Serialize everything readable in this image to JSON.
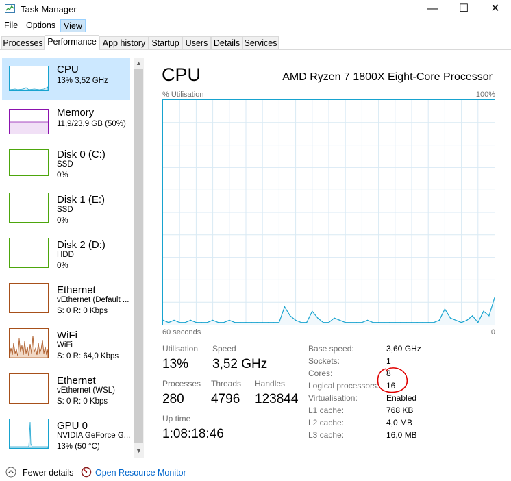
{
  "window": {
    "title": "Task Manager",
    "minimize": "—",
    "maximize": "☐",
    "close": "✕"
  },
  "menu": {
    "file": "File",
    "options": "Options",
    "view": "View"
  },
  "tabs": [
    "Processes",
    "Performance",
    "App history",
    "Startup",
    "Users",
    "Details",
    "Services"
  ],
  "sidebar": [
    {
      "name": "CPU",
      "sub1": "13%  3,52 GHz",
      "sub2": "",
      "color": "#17a3cf"
    },
    {
      "name": "Memory",
      "sub1": "11,9/23,9 GB (50%)",
      "sub2": "",
      "color": "#8b12ae"
    },
    {
      "name": "Disk 0 (C:)",
      "sub1": "SSD",
      "sub2": "0%",
      "color": "#4da60c"
    },
    {
      "name": "Disk 1 (E:)",
      "sub1": "SSD",
      "sub2": "0%",
      "color": "#4da60c"
    },
    {
      "name": "Disk 2 (D:)",
      "sub1": "HDD",
      "sub2": "0%",
      "color": "#4da60c"
    },
    {
      "name": "Ethernet",
      "sub1": "vEthernet (Default ...",
      "sub2": "S: 0  R: 0 Kbps",
      "color": "#a7501a"
    },
    {
      "name": "WiFi",
      "sub1": "WiFi",
      "sub2": "S: 0  R: 64,0 Kbps",
      "color": "#a7501a"
    },
    {
      "name": "Ethernet",
      "sub1": "vEthernet (WSL)",
      "sub2": "S: 0  R: 0 Kbps",
      "color": "#a7501a"
    },
    {
      "name": "GPU 0",
      "sub1": "NVIDIA GeForce G...",
      "sub2": "13%  (50 °C)",
      "color": "#17a3cf"
    }
  ],
  "main": {
    "title": "CPU",
    "processor": "AMD Ryzen 7 1800X Eight-Core Processor",
    "y_label": "% Utilisation",
    "y_max": "100%",
    "x_label": "60 seconds",
    "x_min": "0"
  },
  "chart_data": {
    "type": "area",
    "title": "CPU",
    "ylabel": "% Utilisation",
    "xlabel": "60 seconds",
    "ylim": [
      0,
      100
    ],
    "xlim": [
      60,
      0
    ],
    "x": [
      60,
      59,
      58,
      57,
      56,
      55,
      54,
      53,
      52,
      51,
      50,
      49,
      48,
      47,
      46,
      45,
      44,
      43,
      42,
      41,
      40,
      39,
      38,
      37,
      36,
      35,
      34,
      33,
      32,
      31,
      30,
      29,
      28,
      27,
      26,
      25,
      24,
      23,
      22,
      21,
      20,
      19,
      18,
      17,
      16,
      15,
      14,
      13,
      12,
      11,
      10,
      9,
      8,
      7,
      6,
      5,
      4,
      3,
      2,
      1,
      0
    ],
    "values": [
      2,
      1,
      2,
      1,
      1,
      2,
      1,
      1,
      1,
      2,
      1,
      1,
      2,
      1,
      1,
      1,
      1,
      1,
      1,
      1,
      1,
      1,
      8,
      4,
      2,
      1,
      1,
      6,
      3,
      1,
      1,
      3,
      2,
      1,
      1,
      1,
      1,
      2,
      1,
      1,
      1,
      1,
      1,
      1,
      1,
      1,
      1,
      1,
      1,
      1,
      2,
      7,
      3,
      2,
      1,
      2,
      4,
      1,
      6,
      4,
      12
    ]
  },
  "stats": {
    "utilisation_label": "Utilisation",
    "utilisation": "13%",
    "speed_label": "Speed",
    "speed": "3,52 GHz",
    "processes_label": "Processes",
    "processes": "280",
    "threads_label": "Threads",
    "threads": "4796",
    "handles_label": "Handles",
    "handles": "123844",
    "uptime_label": "Up time",
    "uptime": "1:08:18:46"
  },
  "specs": [
    {
      "label": "Base speed:",
      "value": "3,60 GHz"
    },
    {
      "label": "Sockets:",
      "value": "1"
    },
    {
      "label": "Cores:",
      "value": "8"
    },
    {
      "label": "Logical processors:",
      "value": "16"
    },
    {
      "label": "Virtualisation:",
      "value": "Enabled"
    },
    {
      "label": "L1 cache:",
      "value": "768 KB"
    },
    {
      "label": "L2 cache:",
      "value": "4,0 MB"
    },
    {
      "label": "L3 cache:",
      "value": "16,0 MB"
    }
  ],
  "footer": {
    "fewer_details": "Fewer details",
    "resource_monitor": "Open Resource Monitor"
  },
  "colors": {
    "cpu": "#17a3cf",
    "link": "#0066cc",
    "selected": "#cce8ff",
    "annotation": "#e00000"
  }
}
